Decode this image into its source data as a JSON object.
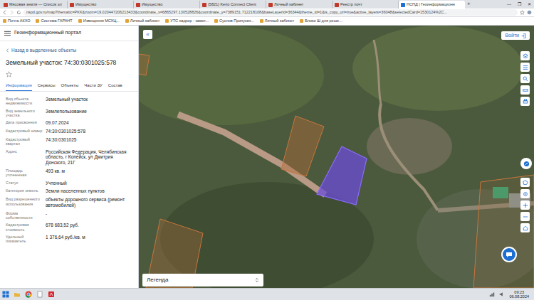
{
  "browser": {
    "tabs": [
      {
        "label": "Мясовая земля — Список эл",
        "selected": false
      },
      {
        "label": "Имущество",
        "selected": false
      },
      {
        "label": "Имущество",
        "selected": false
      },
      {
        "label": "(5821) Kerio Connect Client",
        "selected": false
      },
      {
        "label": "Личный кабинет",
        "selected": false
      },
      {
        "label": "Реестр почт",
        "selected": false
      },
      {
        "label": "НСПД | Геоинформационн",
        "selected": true
      }
    ],
    "new_tab": "+",
    "window_controls": [
      "—",
      "❐",
      "✕"
    ],
    "url": "nspd.gov.ru/map?thematic=PKK&zoom=19.020447206213433&coordinate_x=6865297.130528826&coordinate_y=7389151.712218108&baseLayerId=36344&theme_id=1&is_copy_url=true&active_layers=36048&selectedCard=1530124%2C...",
    "bookmarks": [
      "Почта АКХО",
      "Система ГАРАНТ",
      "Извещения МСХЦ...",
      "Личный кабинет",
      "УТС надзор - замет...",
      "Суслов Пропускн...",
      "Личный кабинет",
      "Блоки Ш для реше..."
    ]
  },
  "app": {
    "title": "Геоинформационный портал"
  },
  "panel": {
    "back": "Назад в выделенные объекты",
    "title": "Земельный участок: 74:30:0301025:578",
    "favorite": false,
    "tabs": [
      {
        "label": "Информация",
        "selected": true
      },
      {
        "label": "Сервисы",
        "selected": false
      },
      {
        "label": "Объекты",
        "selected": false
      },
      {
        "label": "Части ЗУ",
        "selected": false
      },
      {
        "label": "Состав",
        "selected": false
      }
    ],
    "fields": [
      {
        "label": "Вид объекта недвижимости",
        "value": "Земельный участок"
      },
      {
        "label": "Вид земельного участка",
        "value": "Землепользование"
      },
      {
        "label": "Дата присвоения",
        "value": "09.07.2024"
      },
      {
        "label": "Кадастровый номер",
        "value": "74:30:0301025:578"
      },
      {
        "label": "Кадастровый квартал",
        "value": "74:30:0301025"
      },
      {
        "label": "Адрес",
        "value": "Российская Федерация, Челябинская область, г Копейск, ул Дмитрия Донского, 21Г"
      },
      {
        "label": "Площадь уточненная",
        "value": "493 кв. м"
      },
      {
        "label": "Статус",
        "value": "Учтенный"
      },
      {
        "label": "Категория земель",
        "value": "Земли населенных пунктов"
      },
      {
        "label": "Вид разрешенного использования",
        "value": "объекты дорожного сервиса (ремонт автомобилей)"
      },
      {
        "label": "Форма собственности",
        "value": "-"
      },
      {
        "label": "Кадастровая стоимость",
        "value": "678 683,52 руб."
      },
      {
        "label": "Удельный показатель",
        "value": "1 376,64 руб./кв. м"
      }
    ]
  },
  "map": {
    "collapse": "«",
    "login": "Войти",
    "legend": "Легенда"
  },
  "taskbar": {
    "time": "09:23",
    "date": "06.08.2024"
  }
}
